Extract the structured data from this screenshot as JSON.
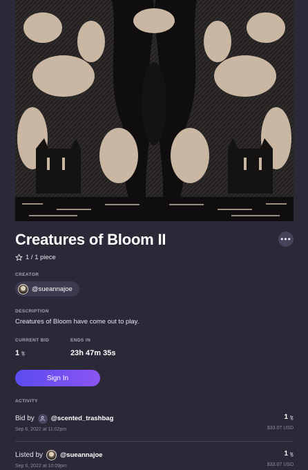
{
  "artwork": {
    "alt_icon": "artwork-image",
    "palette": [
      "#1a1818",
      "#c9b7a3",
      "#2f2c2c"
    ]
  },
  "title": "Creatures of Bloom II",
  "more_button": {
    "label": "•••"
  },
  "edition": {
    "icon": "star-outline-icon",
    "text": "1 / 1 piece"
  },
  "creator": {
    "label": "CREATOR",
    "handle": "@sueannajoe"
  },
  "description": {
    "label": "DESCRIPTION",
    "text": "Creatures of Bloom have come out to play."
  },
  "bid": {
    "label": "CURRENT BID",
    "value": "1",
    "currency_symbol": "ꜩ"
  },
  "ends": {
    "label": "ENDS IN",
    "value": "23h 47m 35s"
  },
  "signin_button": {
    "label": "Sign In"
  },
  "activity": {
    "label": "ACTIVITY",
    "items": [
      {
        "action": "Bid by",
        "user": "@scented_trashbag",
        "date": "Sep 6, 2022 at 11:02pm",
        "amount": "1",
        "currency_symbol": "ꜩ",
        "usd": "$33.07 USD",
        "avatar": "generic-user-icon"
      },
      {
        "action": "Listed by",
        "user": "@sueannajoe",
        "date": "Sep 6, 2022 at 10:09pm",
        "amount": "1",
        "currency_symbol": "ꜩ",
        "usd": "$33.07 USD",
        "avatar": "creator-avatar"
      }
    ]
  },
  "colors": {
    "background": "#2b2937",
    "accent_start": "#5b4cf0",
    "accent_end": "#8b54f2",
    "muted": "#a9a6ba"
  }
}
